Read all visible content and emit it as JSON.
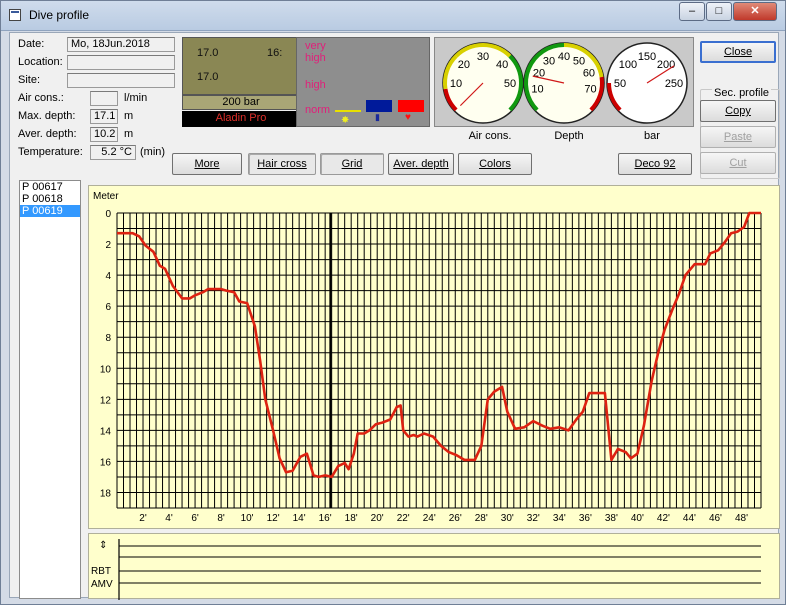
{
  "window": {
    "title": "Dive profile",
    "btn_min": "–",
    "btn_max": "□",
    "btn_close": "✕"
  },
  "info": {
    "date_label": "Date:",
    "date_value": "Mo, 18Jun.2018",
    "location_label": "Location:",
    "location_value": "",
    "site_label": "Site:",
    "site_value": "",
    "air_label": "Air cons.:",
    "air_value": "",
    "air_unit": "l/min",
    "max_label": "Max. depth:",
    "max_value": "17.1",
    "max_unit": "m",
    "aver_label": "Aver. depth:",
    "aver_value": "10.2",
    "aver_unit": "m",
    "temp_label": "Temperature:",
    "temp_value": "5.2 °C",
    "temp_unit": "(min)"
  },
  "lcd": {
    "line1_left": "17.0",
    "line1_right": "16:",
    "line2_left": "17.0",
    "pressure": "200 bar",
    "brand": "Aladin Pro"
  },
  "warnings": {
    "very_high": "very\nhigh",
    "high": "high",
    "norm": "norm"
  },
  "gauges": {
    "air": {
      "caption": "Air cons.",
      "ticks": [
        "10",
        "20",
        "30",
        "40",
        "50"
      ],
      "value": 0
    },
    "depth": {
      "caption": "Depth",
      "ticks": [
        "10",
        "20",
        "30",
        "40",
        "50",
        "60",
        "70"
      ],
      "value": 17
    },
    "bar": {
      "caption": "bar",
      "ticks": [
        "50",
        "100",
        "150",
        "200",
        "250"
      ],
      "value": 214
    }
  },
  "buttons": {
    "close": "Close",
    "sec_profile": "Sec. profile",
    "copy": "Copy",
    "paste": "Paste",
    "cut": "Cut",
    "more": "More",
    "hair_cross": "Hair cross",
    "grid": "Grid",
    "aver_depth": "Aver. depth",
    "colors": "Colors",
    "deco": "Deco 92"
  },
  "profiles": [
    "P 00617",
    "P 00618",
    "P 00619"
  ],
  "selected_profile": "P 00619",
  "chart_data": {
    "type": "line",
    "ylabel": "Meter",
    "x_tick_labels": [
      "2'",
      "4'",
      "6'",
      "8'",
      "10'",
      "12'",
      "14'",
      "16'",
      "18'",
      "20'",
      "22'",
      "24'",
      "26'",
      "28'",
      "30'",
      "32'",
      "34'",
      "36'",
      "38'",
      "40'",
      "42'",
      "44'",
      "46'",
      "48'"
    ],
    "y_tick_labels": [
      "0",
      "2",
      "4",
      "6",
      "8",
      "10",
      "12",
      "14",
      "16",
      "18"
    ],
    "xlim": [
      0,
      49.5
    ],
    "ylim": [
      0,
      19
    ],
    "y_inverted": true,
    "grid": true,
    "cursor_x": 16.4,
    "series": [
      {
        "color": "#dd2211",
        "x": [
          0,
          1.2,
          1.7,
          2.2,
          2.8,
          3.3,
          3.7,
          4.3,
          5.0,
          5.6,
          6.0,
          6.6,
          7.0,
          7.4,
          8.0,
          8.4,
          9.0,
          9.4,
          10.0,
          10.6,
          11.0,
          11.4,
          12.0,
          12.5,
          13.0,
          13.5,
          14.1,
          14.6,
          15.1,
          15.5,
          16.0,
          16.5,
          17.0,
          17.5,
          17.8,
          18.2,
          18.5,
          19.0,
          19.4,
          19.9,
          20.4,
          21.0,
          21.5,
          21.8,
          22.0,
          22.4,
          22.8,
          23.1,
          23.6,
          24.3,
          24.9,
          25.5,
          26.1,
          26.7,
          27.5,
          28.0,
          28.5,
          29.0,
          29.6,
          30.0,
          30.6,
          31.3,
          32.0,
          32.7,
          33.3,
          34.0,
          34.7,
          35.3,
          35.8,
          36.3,
          36.9,
          37.5,
          38.0,
          38.5,
          39.1,
          39.5,
          40.0,
          40.5,
          41.1,
          41.6,
          42.1,
          42.7,
          43.2,
          43.7,
          44.4,
          44.8,
          45.2,
          45.6,
          46.2,
          46.7,
          47.2,
          47.7,
          48.2,
          48.6,
          49.0,
          49.5
        ],
        "y": [
          1.3,
          1.3,
          1.5,
          2.1,
          2.5,
          3.4,
          3.6,
          4.7,
          5.5,
          5.5,
          5.3,
          5.1,
          4.9,
          4.9,
          4.9,
          5.0,
          5.1,
          5.7,
          5.8,
          7.3,
          9.5,
          12.0,
          14.0,
          15.8,
          16.7,
          16.6,
          15.7,
          15.5,
          16.9,
          17.0,
          16.9,
          17.0,
          16.3,
          16.1,
          16.5,
          15.5,
          14.2,
          14.2,
          14.0,
          13.6,
          13.5,
          13.3,
          12.5,
          12.4,
          14.0,
          14.4,
          14.3,
          14.4,
          14.2,
          14.4,
          15.0,
          15.4,
          15.6,
          15.9,
          15.9,
          15.0,
          12.0,
          11.5,
          11.2,
          12.8,
          13.9,
          13.8,
          13.4,
          13.7,
          13.9,
          13.8,
          14.0,
          13.3,
          12.8,
          11.6,
          11.6,
          11.6,
          15.9,
          15.2,
          15.4,
          15.8,
          15.5,
          13.7,
          10.8,
          9.0,
          7.5,
          6.2,
          5.2,
          4.0,
          3.3,
          3.3,
          3.3,
          2.6,
          2.4,
          1.9,
          1.3,
          1.2,
          0.9,
          0,
          0,
          0
        ]
      }
    ]
  },
  "bottom_panel": {
    "rbt_label": "RBT",
    "amv_label": "AMV"
  }
}
